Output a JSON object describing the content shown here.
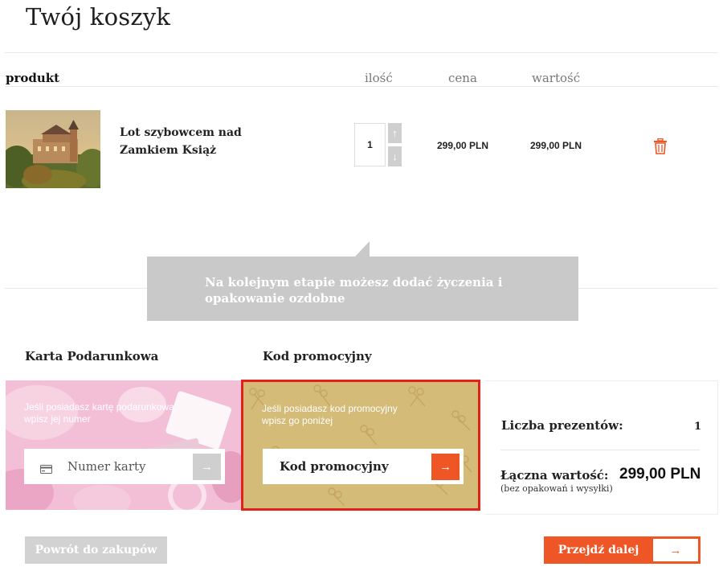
{
  "page": {
    "title": "Twój koszyk"
  },
  "cart_table": {
    "headers": {
      "product": "produkt",
      "quantity": "ilość",
      "price": "cena",
      "value": "wartość"
    },
    "items": [
      {
        "name": "Lot szybowcem nad Zamkiem Książ",
        "image_icon": "castle-photo",
        "quantity": "1",
        "price": "299,00 PLN",
        "value": "299,00 PLN",
        "delete_icon": "trash-icon"
      }
    ]
  },
  "quantity_controls": {
    "up": "↑",
    "down": "↓"
  },
  "tooltip": {
    "text": "Na kolejnym etapie możesz dodać życzenia i opakowanie ozdobne"
  },
  "gift_card": {
    "title": "Karta Podarunkowa",
    "description": "Jeśli posiadasz kartę podarunkową, wpisz jej numer",
    "placeholder": "Numer karty",
    "submit_icon": "→"
  },
  "promo_code": {
    "title": "Kod promocyjny",
    "description": "Jeśli posiadasz kod promocyjny wpisz go poniżej",
    "placeholder": "Kod promocyjny",
    "submit_icon": "→"
  },
  "summary": {
    "gift_count_label": "Liczba prezentów:",
    "gift_count": "1",
    "total_label": "Łączna wartość:",
    "total_note": "(bez opakowań i wysyłki)",
    "total_value": "299,00 PLN"
  },
  "actions": {
    "back_label": "Powrót do zakupów",
    "next_label": "Przejdź dalej",
    "next_arrow": "→"
  },
  "colors": {
    "accent": "#ef5626",
    "highlight_border": "#e0221b",
    "promo_bg": "#d5bb78",
    "gift_bg": "#f0b9d2",
    "muted_button": "#d2d2d2",
    "tooltip_bg": "#c9c9c9"
  }
}
